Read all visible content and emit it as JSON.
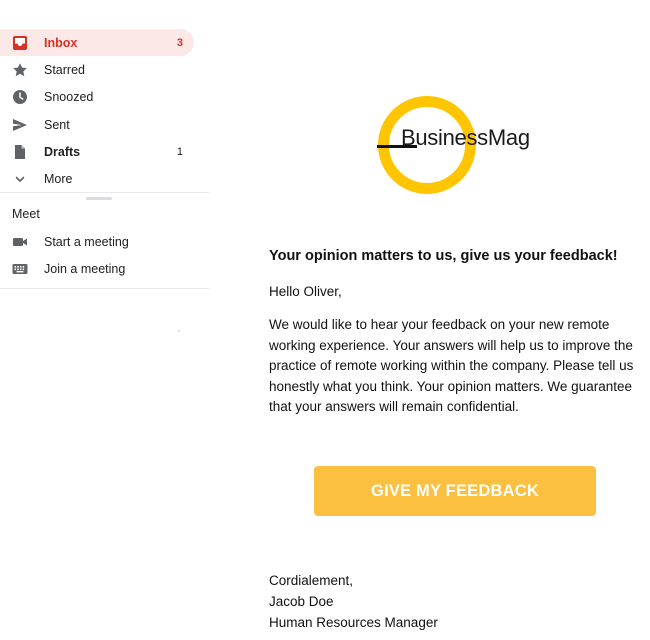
{
  "sidebar": {
    "items": [
      {
        "label": "Inbox",
        "count": "3",
        "icon": "inbox-icon"
      },
      {
        "label": "Starred",
        "count": "",
        "icon": "star-icon"
      },
      {
        "label": "Snoozed",
        "count": "",
        "icon": "clock-icon"
      },
      {
        "label": "Sent",
        "count": "",
        "icon": "send-icon"
      },
      {
        "label": "Drafts",
        "count": "1",
        "icon": "draft-icon"
      },
      {
        "label": "More",
        "count": "",
        "icon": "chevron-down-icon"
      }
    ],
    "meet": {
      "heading": "Meet",
      "items": [
        {
          "label": "Start a meeting",
          "icon": "video-camera-icon"
        },
        {
          "label": "Join a meeting",
          "icon": "keyboard-icon"
        }
      ]
    }
  },
  "email": {
    "logo_text": "BusinessMag",
    "headline": "Your opinion matters to us, give us your feedback!",
    "greeting": "Hello Oliver,",
    "paragraph": "We would like to hear your feedback on your new remote working experience. Your answers will help us to improve the practice of remote working within the company. Please tell us honestly what you think. Your opinion matters. We guarantee that your answers will remain confidential.",
    "cta_label": "GIVE MY FEEDBACK",
    "signature": {
      "closing": "Cordialement,",
      "name": "Jacob Doe",
      "title": "Human Resources Manager"
    }
  },
  "colors": {
    "inbox_active_bg": "#fce8e6",
    "inbox_active_text": "#d93025",
    "logo_ring": "#ffc500",
    "cta_bg": "#fbc03f",
    "cta_text": "#ffffff"
  }
}
